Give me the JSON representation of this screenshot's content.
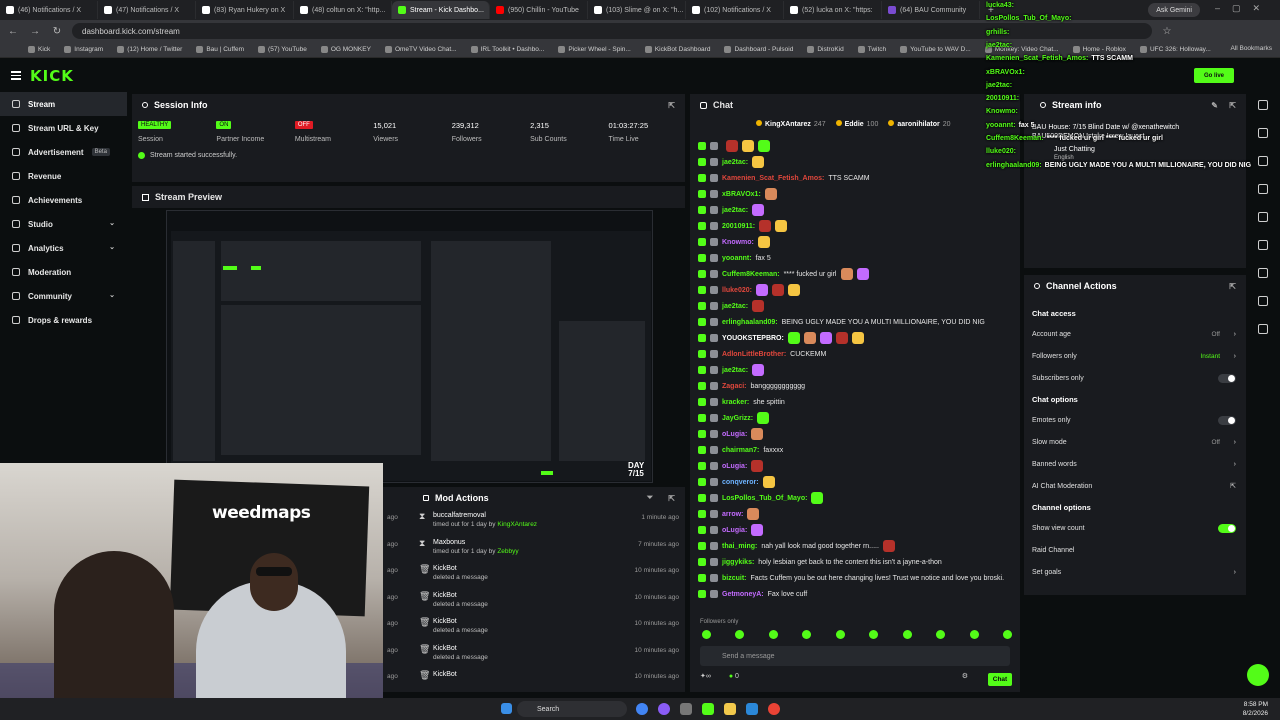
{
  "browser": {
    "tabs": [
      {
        "label": "(46) Notifications / X",
        "icon": "x"
      },
      {
        "label": "(47) Notifications / X",
        "icon": "x"
      },
      {
        "label": "(83) Ryan Hukery on X",
        "icon": "x"
      },
      {
        "label": "(48) coltun on X: \"http...",
        "icon": "x"
      },
      {
        "label": "Stream - Kick Dashbo...",
        "icon": "kick"
      },
      {
        "label": "(950) Chillin - YouTube",
        "icon": "yt"
      },
      {
        "label": "(103) Slime @ on X: \"h...",
        "icon": "x"
      },
      {
        "label": "(102) Notifications / X",
        "icon": "x"
      },
      {
        "label": "(52) lucka on X: \"https:",
        "icon": "x"
      },
      {
        "label": "(64) BAU Community",
        "icon": "bau"
      }
    ],
    "ask_gemini": "Ask Gemini",
    "url": "dashboard.kick.com/stream",
    "bookmarks": [
      "Kick",
      "Instagram",
      "(12) Home / Twitter",
      "Bau | Cuffem",
      "(57) YouTube",
      "OG MONKEY",
      "OmeTV Video Chat...",
      "IRL Toolkit • Dashbo...",
      "Picker Wheel - Spin...",
      "KickBot Dashboard",
      "Dashboard - Pulsoid",
      "DistroKid",
      "Twitch",
      "YouTube to WAV D...",
      "Monkey: Video Chat...",
      "Home - Roblox",
      "UFC 326: Holloway..."
    ],
    "all_bookmarks": "All Bookmarks"
  },
  "header": {
    "logo": "KICK",
    "go_live": "Go live"
  },
  "sidebar": {
    "items": [
      {
        "label": "Stream",
        "active": true
      },
      {
        "label": "Stream URL & Key"
      },
      {
        "label": "Advertisement",
        "badge": "Beta"
      },
      {
        "label": "Revenue"
      },
      {
        "label": "Achievements"
      },
      {
        "label": "Studio",
        "chevron": true
      },
      {
        "label": "Analytics",
        "chevron": true
      },
      {
        "label": "Moderation"
      },
      {
        "label": "Community",
        "chevron": true
      },
      {
        "label": "Drops & rewards"
      }
    ]
  },
  "session": {
    "title": "Session Info",
    "stats": [
      {
        "value": "HEALTHY",
        "label": "Session",
        "kind": "pill-green"
      },
      {
        "value": "ON",
        "label": "Partner Income",
        "kind": "pill-green"
      },
      {
        "value": "OFF",
        "label": "Multistream",
        "kind": "pill-red"
      },
      {
        "value": "15,021",
        "label": "Viewers",
        "kind": "text"
      },
      {
        "value": "239,312",
        "label": "Followers",
        "kind": "text"
      },
      {
        "value": "2,315",
        "label": "Sub Counts",
        "kind": "text"
      },
      {
        "value": "01:03:27:25",
        "label": "Time Live",
        "kind": "text"
      }
    ],
    "status": "Stream started successfully."
  },
  "preview": {
    "title": "Stream Preview",
    "day_badge_line1": "DAY",
    "day_badge_line2": "7/15"
  },
  "webcam": {
    "brand": "weedmaps"
  },
  "mod_actions": {
    "title": "Mod Actions",
    "rows": [
      {
        "title": "buccalfatremoval",
        "sub_prefix": "timed out for 1 day by ",
        "sub_user": "KingXAntarez",
        "time": "1 minute ago",
        "icon": "hourglass"
      },
      {
        "title": "Maxbonus",
        "sub_prefix": "timed out for 1 day by ",
        "sub_user": "Zebbyy",
        "time": "7 minutes ago",
        "icon": "hourglass"
      },
      {
        "title": "KickBot",
        "sub_prefix": "deleted a message",
        "sub_user": "",
        "time": "10 minutes ago",
        "icon": "trash"
      },
      {
        "title": "KickBot",
        "sub_prefix": "deleted a message",
        "sub_user": "",
        "time": "10 minutes ago",
        "icon": "trash"
      },
      {
        "title": "KickBot",
        "sub_prefix": "deleted a message",
        "sub_user": "",
        "time": "10 minutes ago",
        "icon": "trash"
      },
      {
        "title": "KickBot",
        "sub_prefix": "deleted a message",
        "sub_user": "",
        "time": "10 minutes ago",
        "icon": "trash"
      },
      {
        "title": "KickBot",
        "sub_prefix": "",
        "sub_user": "",
        "time": "10 minutes ago",
        "icon": "trash"
      }
    ],
    "edge_labels": [
      "ago",
      "ago",
      "ago",
      "ago",
      "ago",
      "ago",
      "ago"
    ]
  },
  "chat": {
    "title": "Chat",
    "gifters": [
      {
        "name": "KingXAntarez",
        "count": "247"
      },
      {
        "name": "Eddie",
        "count": "100"
      },
      {
        "name": "aaronihilator",
        "count": "20"
      }
    ],
    "messages": [
      {
        "user": "",
        "color": "#ffffff",
        "text": "",
        "emotes": 3
      },
      {
        "user": "jae2tac:",
        "color": "#53fc18",
        "text": "",
        "emotes": 1
      },
      {
        "user": "Kamenien_Scat_Fetish_Amos:",
        "color": "#e0473c",
        "text": "TTS SCAMM",
        "emotes": 0
      },
      {
        "user": "xBRAVOx1:",
        "color": "#53fc18",
        "text": "",
        "emotes": 1
      },
      {
        "user": "jae2tac:",
        "color": "#53fc18",
        "text": "",
        "emotes": 1
      },
      {
        "user": "20010911:",
        "color": "#53fc18",
        "text": "",
        "emotes": 2
      },
      {
        "user": "Knowmo:",
        "color": "#c36bff",
        "text": "",
        "emotes": 1
      },
      {
        "user": "yooannt:",
        "color": "#53fc18",
        "text": "fax 5",
        "emotes": 0
      },
      {
        "user": "Cuffem8Keeman:",
        "color": "#53fc18",
        "text": "**** fucked ur girl",
        "emotes": 2
      },
      {
        "user": "lluke020:",
        "color": "#e0473c",
        "text": "",
        "emotes": 3
      },
      {
        "user": "jae2tac:",
        "color": "#53fc18",
        "text": "",
        "emotes": 1
      },
      {
        "user": "erlinghaaland09:",
        "color": "#53fc18",
        "text": "BEING UGLY MADE YOU A MULTI MILLIONAIRE, YOU DID NIG",
        "emotes": 0
      },
      {
        "user": "YOUOKSTEPBRO:",
        "color": "#ffffff",
        "text": "",
        "emotes": 5
      },
      {
        "user": "AdlonLittleBrother:",
        "color": "#e0473c",
        "text": "CUCKEMM",
        "emotes": 0
      },
      {
        "user": "jae2tac:",
        "color": "#53fc18",
        "text": "",
        "emotes": 1
      },
      {
        "user": "Zagaci:",
        "color": "#e0473c",
        "text": "banggggggggggg",
        "emotes": 0
      },
      {
        "user": "kracker:",
        "color": "#53fc18",
        "text": "she spittin",
        "emotes": 0
      },
      {
        "user": "JayGrizz:",
        "color": "#53fc18",
        "text": "",
        "emotes": 1
      },
      {
        "user": "oLugia:",
        "color": "#c36bff",
        "text": "",
        "emotes": 1
      },
      {
        "user": "chairman7:",
        "color": "#53fc18",
        "text": "faxxxx",
        "emotes": 0
      },
      {
        "user": "oLugia:",
        "color": "#c36bff",
        "text": "",
        "emotes": 1
      },
      {
        "user": "conqveror:",
        "color": "#6db3ff",
        "text": "",
        "emotes": 1
      },
      {
        "user": "LosPollos_Tub_Of_Mayo:",
        "color": "#53fc18",
        "text": "",
        "emotes": 1
      },
      {
        "user": "arrow:",
        "color": "#c36bff",
        "text": "",
        "emotes": 1
      },
      {
        "user": "oLugia:",
        "color": "#c36bff",
        "text": "",
        "emotes": 1
      },
      {
        "user": "thai_ming:",
        "color": "#53fc18",
        "text": "nah yall look mad good together rn.....",
        "emotes": 1
      },
      {
        "user": "jiggykiks:",
        "color": "#53fc18",
        "text": "holy lesbian get back to the content this isn't a jayne-a-thon",
        "emotes": 0
      },
      {
        "user": "bizcuit:",
        "color": "#53fc18",
        "text": "Facts Cuffem you be out here changing lives! Trust we notice and love you broski.",
        "emotes": 0
      },
      {
        "user": "GetmoneyA:",
        "color": "#c36bff",
        "text": "Fax love cuff",
        "emotes": 0
      }
    ],
    "followers_only": "Followers only",
    "input_placeholder": "Send a message",
    "points": "0",
    "send_label": "Chat"
  },
  "stream_info": {
    "title": "Stream info",
    "stream_title": "BAU House: 7/15 Blind Date w/ @xenathewitch",
    "tags": "BAU500DEMON Istake Icrew Iguest",
    "category": "Just Chatting",
    "language": "English"
  },
  "channel_actions": {
    "title": "Channel Actions",
    "sections": [
      {
        "heading": "Chat access",
        "rows": [
          {
            "label": "Account age",
            "value": "Off",
            "type": "arrow"
          },
          {
            "label": "Followers only",
            "value": "Instant",
            "type": "arrow",
            "green": true
          },
          {
            "label": "Subscribers only",
            "value": "",
            "type": "toggle-off"
          }
        ]
      },
      {
        "heading": "Chat options",
        "rows": [
          {
            "label": "Emotes only",
            "value": "",
            "type": "toggle-off"
          },
          {
            "label": "Slow mode",
            "value": "Off",
            "type": "arrow"
          },
          {
            "label": "Banned words",
            "value": "",
            "type": "arrow"
          },
          {
            "label": "AI Chat Moderation",
            "value": "",
            "type": "external"
          }
        ]
      },
      {
        "heading": "Channel options",
        "rows": [
          {
            "label": "Show view count",
            "value": "",
            "type": "toggle-on"
          },
          {
            "label": "Raid Channel",
            "value": "",
            "type": "none"
          },
          {
            "label": "Set goals",
            "value": "",
            "type": "arrow"
          }
        ]
      }
    ]
  },
  "overlay_chat": [
    {
      "user": "lucka43:",
      "text": ""
    },
    {
      "user": "LosPollos_Tub_Of_Mayo:",
      "text": ""
    },
    {
      "user": "grhills:",
      "text": ""
    },
    {
      "user": "jae2tac:",
      "text": ""
    },
    {
      "user": "Kamenien_Scat_Fetish_Amos:",
      "text": "TTS SCAMM"
    },
    {
      "user": "xBRAVOx1:",
      "text": ""
    },
    {
      "user": "jae2tac:",
      "text": ""
    },
    {
      "user": "20010911:",
      "text": ""
    },
    {
      "user": "Knowmo:",
      "text": ""
    },
    {
      "user": "yooannt:",
      "text": "fax 5"
    },
    {
      "user": "Cuffem8Keeman:",
      "text": "**** fucked ur girl **** fucked ur girl"
    },
    {
      "user": "lluke020:",
      "text": ""
    },
    {
      "user": "erlinghaaland09:",
      "text": "BEING UGLY MADE YOU A MULTI MILLIONAIRE, YOU DID NIG"
    }
  ],
  "taskbar": {
    "search": "Search",
    "time": "8:58 PM",
    "date": "8/2/2026"
  }
}
